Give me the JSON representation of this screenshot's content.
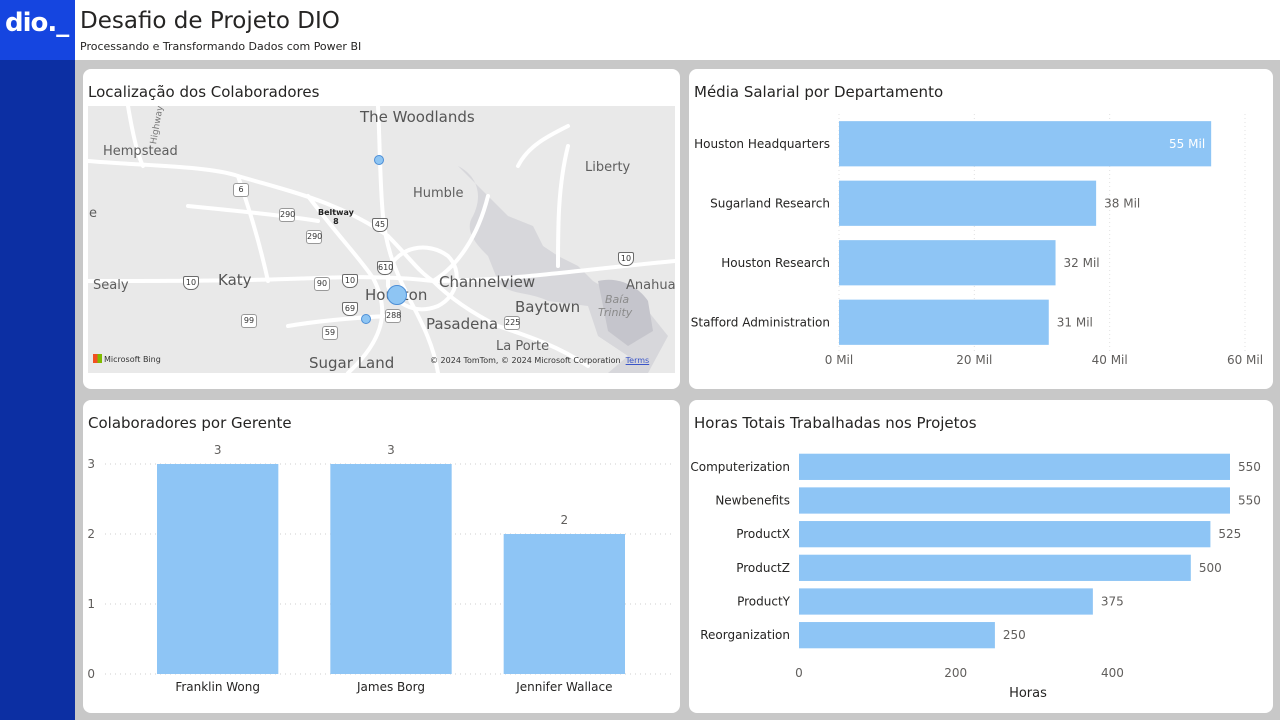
{
  "brand": {
    "logo_text": "dio._"
  },
  "header": {
    "title": "Desafio de Projeto DIO",
    "subtitle": "Processando e Transformando Dados com Power BI"
  },
  "colors": {
    "bar": "#8ec5f5",
    "sidebar": "#0c2fa3",
    "logo_bg": "#1545e0",
    "canvas": "#c8c8c8"
  },
  "map_card": {
    "title": "Localização dos Colaboradores",
    "cities": {
      "the_woodlands": "The Woodlands",
      "hempstead": "Hempstead",
      "liberty": "Liberty",
      "humble": "Humble",
      "katy": "Katy",
      "sealy": "Sealy",
      "channelview": "Channelview",
      "anahuac": "Anahuac",
      "houston": "Houston",
      "baytown": "Baytown",
      "pasadena": "Pasadena",
      "la_porte": "La Porte",
      "sugar_land": "Sugar Land",
      "highway": "Highway",
      "e_edge": "e",
      "baia": "Baía",
      "trinity": "Trinity"
    },
    "shields": {
      "s6": "6",
      "s290a": "290",
      "s290b": "290",
      "s45": "45",
      "s610": "610",
      "s10a": "10",
      "s10b": "10",
      "s10c": "10",
      "s90": "90",
      "s69": "69",
      "s288": "288",
      "s225": "225",
      "s99": "99",
      "s59": "59"
    },
    "beltway": {
      "line1": "Beltway",
      "line2": "8"
    },
    "bing_label": "Microsoft Bing",
    "attribution": "© 2024 TomTom, © 2024 Microsoft Corporation",
    "terms": "Terms"
  },
  "salary_card": {
    "title": "Média Salarial por Departamento",
    "chart_data": {
      "type": "bar",
      "orientation": "horizontal",
      "categories": [
        "Houston Headquarters",
        "Sugarland Research",
        "Houston Research",
        "Stafford Administration"
      ],
      "values": [
        55,
        38,
        32,
        31
      ],
      "data_labels": [
        "55 Mil",
        "38 Mil",
        "32 Mil",
        "31 Mil"
      ],
      "xlim": [
        0,
        60
      ],
      "x_ticks": [
        0,
        20,
        40,
        60
      ],
      "x_tick_labels": [
        "0 Mil",
        "20 Mil",
        "40 Mil",
        "60 Mil"
      ],
      "grid": true
    }
  },
  "manager_card": {
    "title": "Colaboradores por Gerente",
    "chart_data": {
      "type": "bar",
      "orientation": "vertical",
      "categories": [
        "Franklin Wong",
        "James Borg",
        "Jennifer Wallace"
      ],
      "values": [
        3,
        3,
        2
      ],
      "data_labels": [
        "3",
        "3",
        "2"
      ],
      "ylim": [
        0,
        3
      ],
      "y_ticks": [
        0,
        1,
        2,
        3
      ],
      "y_tick_labels": [
        "0",
        "1",
        "2",
        "3"
      ],
      "grid": true
    }
  },
  "hours_card": {
    "title": "Horas Totais Trabalhadas nos Projetos",
    "chart_data": {
      "type": "bar",
      "orientation": "horizontal",
      "categories": [
        "Computerization",
        "Newbenefits",
        "ProductX",
        "ProductZ",
        "ProductY",
        "Reorganization"
      ],
      "values": [
        550,
        550,
        525,
        500,
        375,
        250
      ],
      "data_labels": [
        "550",
        "550",
        "525",
        "500",
        "375",
        "250"
      ],
      "xlim": [
        0,
        550
      ],
      "x_ticks": [
        0,
        200,
        400
      ],
      "x_tick_labels": [
        "0",
        "200",
        "400"
      ],
      "xlabel": "Horas",
      "grid": false
    }
  }
}
